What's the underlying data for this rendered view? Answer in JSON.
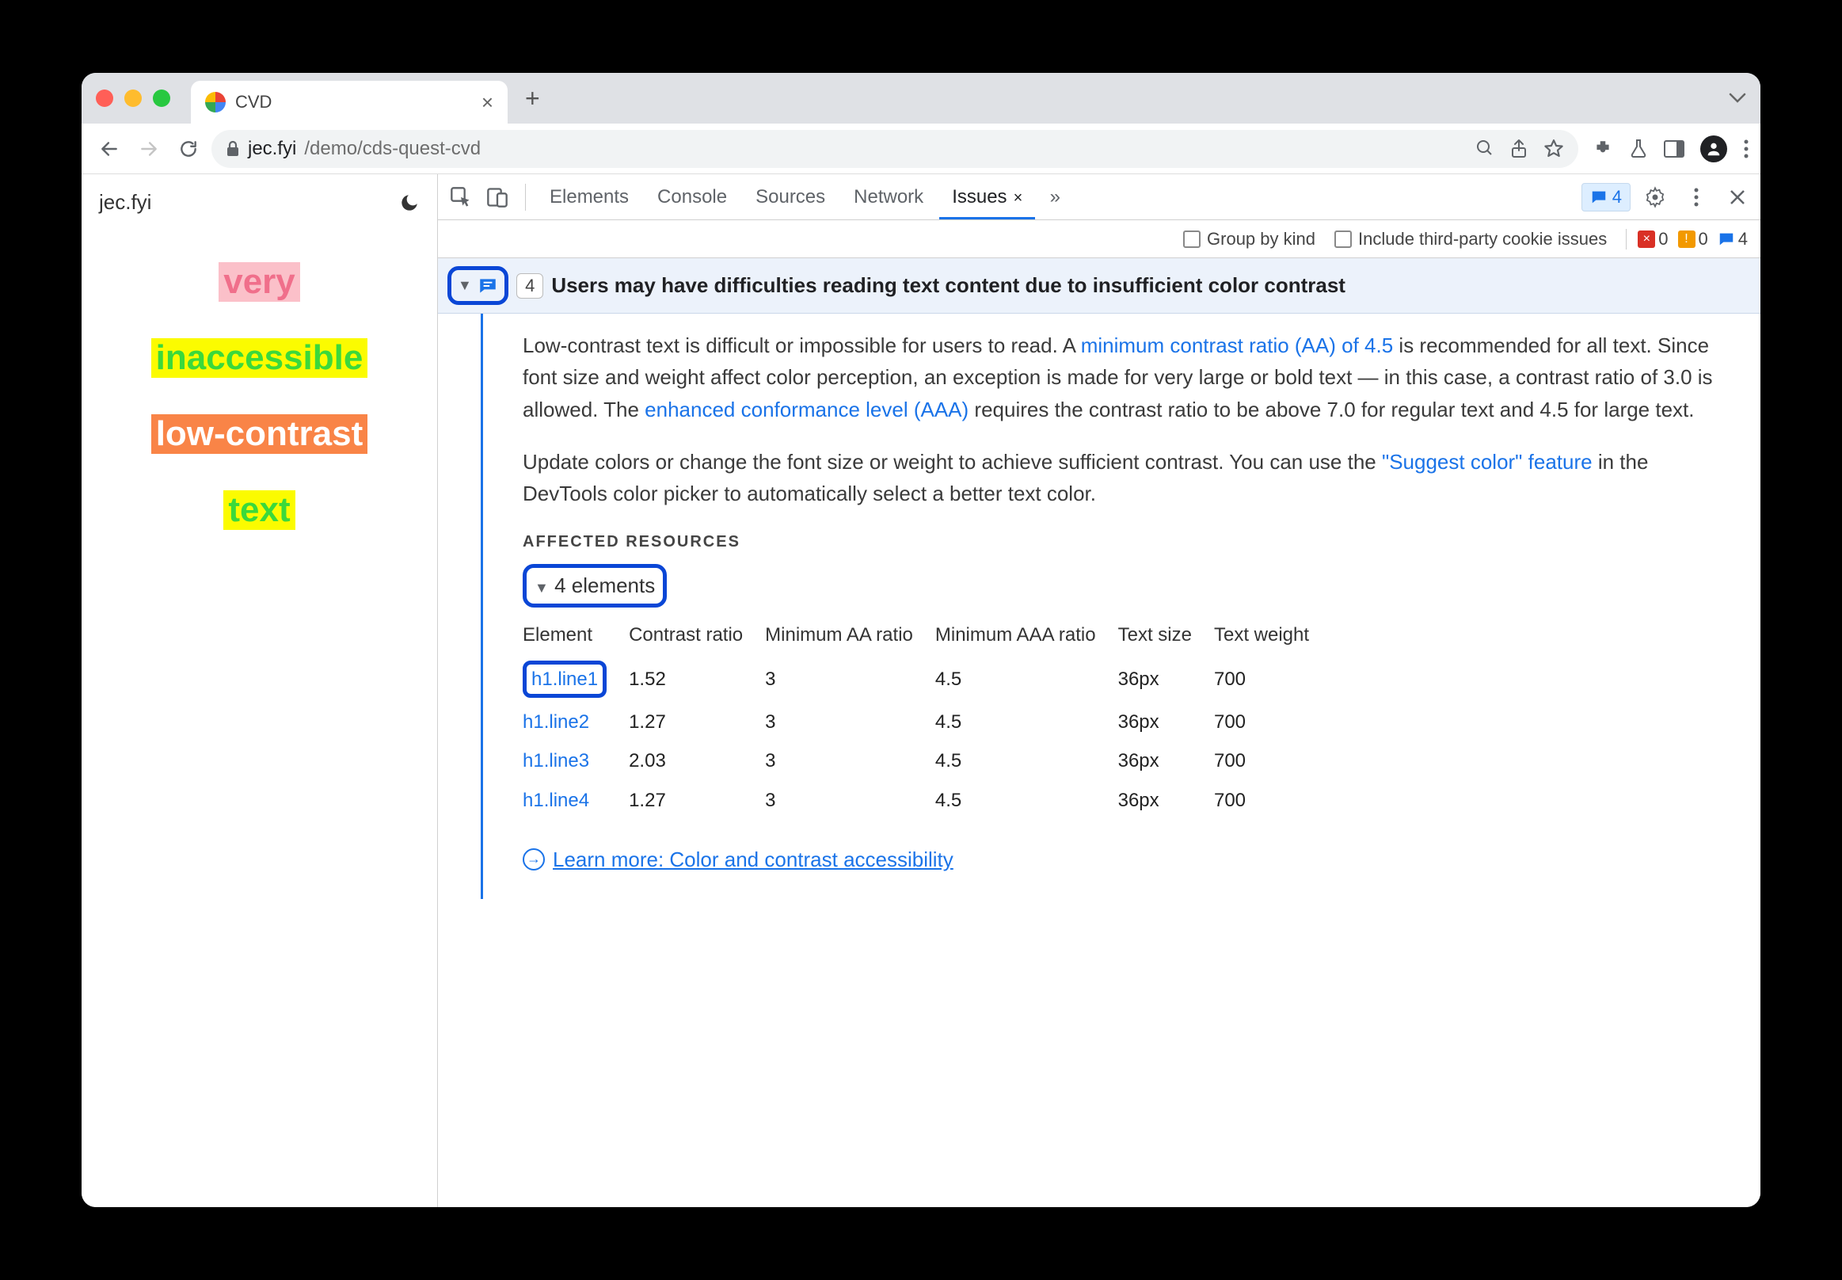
{
  "tab": {
    "title": "CVD"
  },
  "address": {
    "host": "jec.fyi",
    "path": "/demo/cds-quest-cvd"
  },
  "site": {
    "brand": "jec.fyi"
  },
  "demo": [
    "very",
    "inaccessible",
    "low-contrast",
    "text"
  ],
  "devtools": {
    "tabs": [
      "Elements",
      "Console",
      "Sources",
      "Network",
      "Issues"
    ],
    "active_tab": "Issues",
    "badge_count": "4",
    "filter": {
      "group_by_kind": "Group by kind",
      "third_party": "Include third-party cookie issues"
    },
    "counters": {
      "errors": "0",
      "warnings": "0",
      "issues": "4"
    }
  },
  "issue": {
    "count": "4",
    "title": "Users may have difficulties reading text content due to insufficient color contrast",
    "p1a": "Low-contrast text is difficult or impossible for users to read. A ",
    "link1": "minimum contrast ratio (AA) of 4.5",
    "p1b": " is recommended for all text. Since font size and weight affect color perception, an exception is made for very large or bold text — in this case, a contrast ratio of 3.0 is allowed. The ",
    "link2": "enhanced conformance level (AAA)",
    "p1c": " requires the contrast ratio to be above 7.0 for regular text and 4.5 for large text.",
    "p2a": "Update colors or change the font size or weight to achieve sufficient contrast. You can use the ",
    "link3": "\"Suggest color\" feature",
    "p2b": " in the DevTools color picker to automatically select a better text color.",
    "affected_label": "AFFECTED RESOURCES",
    "elements_label": "4 elements",
    "columns": [
      "Element",
      "Contrast ratio",
      "Minimum AA ratio",
      "Minimum AAA ratio",
      "Text size",
      "Text weight"
    ],
    "rows": [
      {
        "el": "h1.line1",
        "cr": "1.52",
        "aa": "3",
        "aaa": "4.5",
        "size": "36px",
        "wt": "700"
      },
      {
        "el": "h1.line2",
        "cr": "1.27",
        "aa": "3",
        "aaa": "4.5",
        "size": "36px",
        "wt": "700"
      },
      {
        "el": "h1.line3",
        "cr": "2.03",
        "aa": "3",
        "aaa": "4.5",
        "size": "36px",
        "wt": "700"
      },
      {
        "el": "h1.line4",
        "cr": "1.27",
        "aa": "3",
        "aaa": "4.5",
        "size": "36px",
        "wt": "700"
      }
    ],
    "learn_more": "Learn more: Color and contrast accessibility"
  }
}
